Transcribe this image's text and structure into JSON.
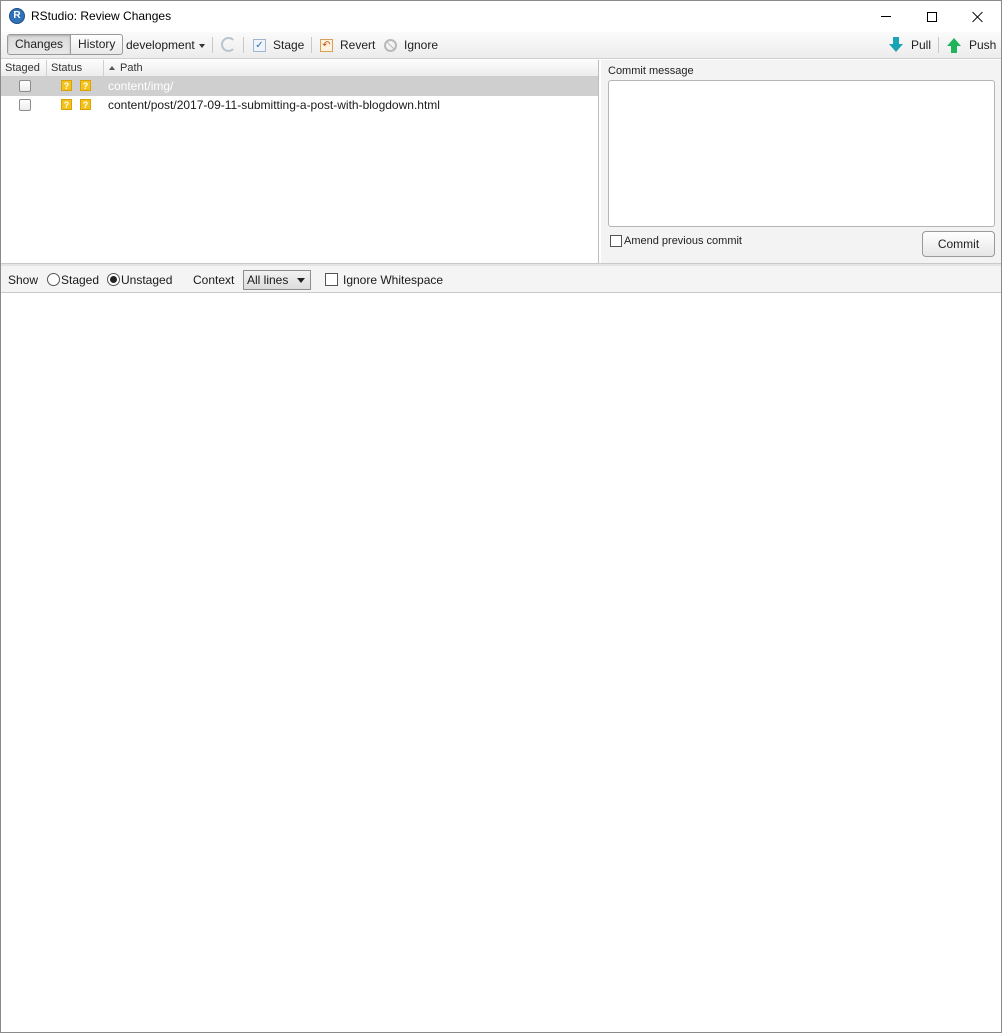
{
  "window": {
    "title": "RStudio: Review Changes",
    "app_icon_letter": "R"
  },
  "toolbar": {
    "tabs": [
      {
        "label": "Changes",
        "active": true
      },
      {
        "label": "History",
        "active": false
      }
    ],
    "branch": "development",
    "stage_label": "Stage",
    "revert_label": "Revert",
    "ignore_label": "Ignore",
    "pull_label": "Pull",
    "push_label": "Push"
  },
  "files": {
    "columns": {
      "staged": "Staged",
      "status": "Status",
      "path": "Path"
    },
    "rows": [
      {
        "staged": false,
        "status": [
          "?",
          "?"
        ],
        "path": "content/img/",
        "selected": true
      },
      {
        "staged": false,
        "status": [
          "?",
          "?"
        ],
        "path": "content/post/2017-09-11-submitting-a-post-with-blogdown.html",
        "selected": false
      }
    ]
  },
  "commit": {
    "label": "Commit message",
    "message": "",
    "amend_label": "Amend previous commit",
    "amend_checked": false,
    "button_label": "Commit"
  },
  "diff_toolbar": {
    "show_label": "Show",
    "staged_label": "Staged",
    "unstaged_label": "Unstaged",
    "selected_view": "Unstaged",
    "context_label": "Context",
    "context_value": "All lines",
    "ignore_ws_label": "Ignore Whitespace",
    "ignore_ws_checked": false
  },
  "colors": {
    "status_untracked": "#f3c21b",
    "pull_arrow": "#1aa3b5",
    "push_arrow": "#21b35a",
    "selection": "#cfcfcf"
  }
}
